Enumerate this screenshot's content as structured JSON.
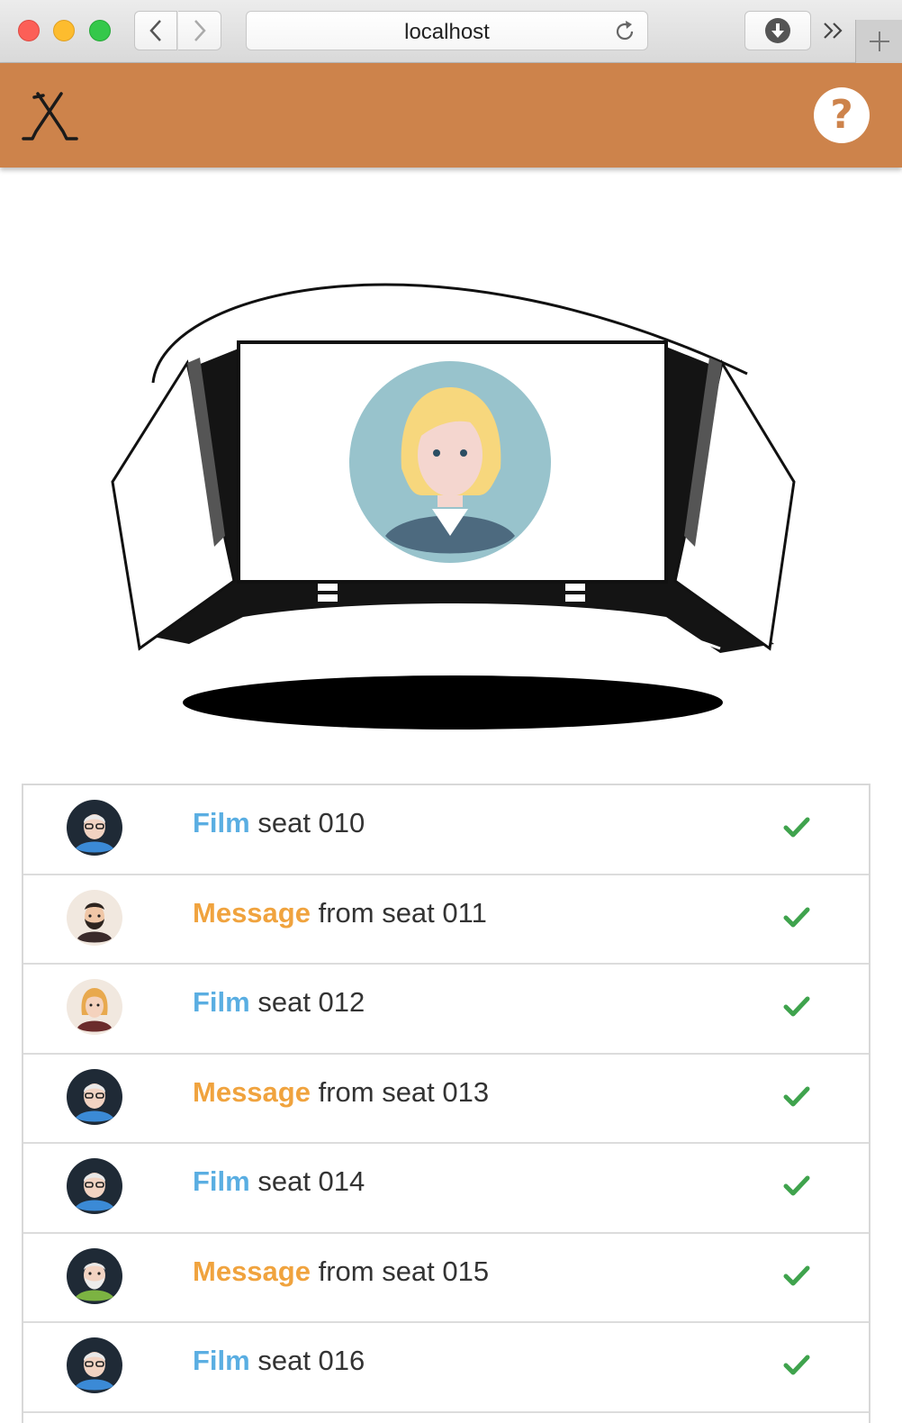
{
  "browser": {
    "url": "localhost"
  },
  "app": {
    "help_label": "?"
  },
  "rows": [
    {
      "kind": "film",
      "keyword": "Film",
      "text": " seat 010",
      "avatar": "older-man-glasses-avatar"
    },
    {
      "kind": "message",
      "keyword": "Message",
      "text": " from seat 011",
      "avatar": "bearded-man-avatar"
    },
    {
      "kind": "film",
      "keyword": "Film",
      "text": " seat 012",
      "avatar": "woman-avatar"
    },
    {
      "kind": "message",
      "keyword": "Message",
      "text": " from seat 013",
      "avatar": "older-man-glasses-avatar"
    },
    {
      "kind": "film",
      "keyword": "Film",
      "text": " seat 014",
      "avatar": "older-man-glasses-avatar"
    },
    {
      "kind": "message",
      "keyword": "Message",
      "text": " from seat 015",
      "avatar": "bearded-older-man-avatar"
    },
    {
      "kind": "film",
      "keyword": "Film",
      "text": " seat 016",
      "avatar": "older-man-glasses-avatar"
    }
  ],
  "colors": {
    "brand": "#cd834b",
    "film": "#5aaee2",
    "message": "#f0a33e",
    "check": "#3fa34d"
  }
}
